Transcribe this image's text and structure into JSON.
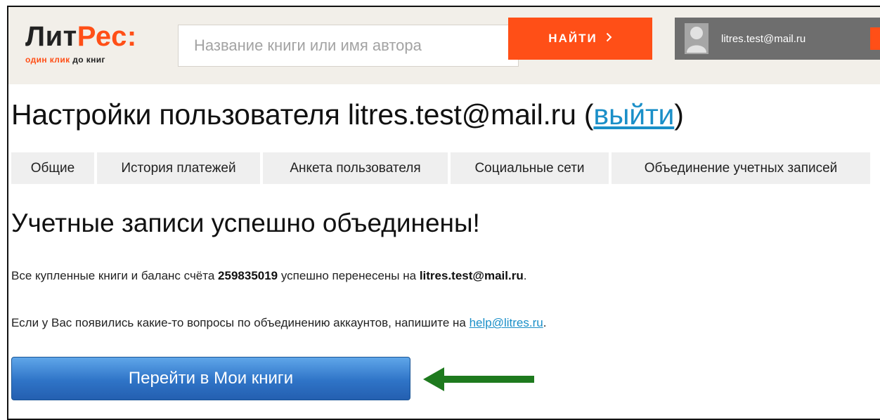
{
  "header": {
    "logo_part1": "Лит",
    "logo_part2": "Рес:",
    "tagline_part1": "один клик",
    "tagline_part2": " до книг",
    "search_placeholder": "Название книги или имя автора",
    "search_button": "НАЙТИ",
    "search_button_icon": "chevron-right-icon",
    "user_email": "litres.test@mail.ru"
  },
  "page": {
    "title_prefix": "Настройки пользователя litres.test@mail.ru (",
    "logout_link": "выйти",
    "title_suffix": ")"
  },
  "tabs": [
    {
      "label": "Общие"
    },
    {
      "label": "История платежей"
    },
    {
      "label": "Анкета пользователя"
    },
    {
      "label": "Социальные сети"
    },
    {
      "label": "Объединение учетных записей"
    }
  ],
  "content": {
    "success_title": "Учетные записи успешно объединены!",
    "line1_before": "Все купленные книги и баланс счёта ",
    "account_number": "259835019",
    "line1_middle": " успешно перенесены на ",
    "target_email": "litres.test@mail.ru",
    "line1_end": ".",
    "line2_before": "Если у Вас появились какие-то вопросы по объединению аккаунтов, напишите на ",
    "help_email": "help@litres.ru",
    "line2_end": ".",
    "go_button": "Перейти в Мои книги"
  },
  "colors": {
    "accent_orange": "#ff4f17",
    "link_blue": "#1a8fc8",
    "arrow_green": "#1e7a1e",
    "button_blue": "#2f74c7"
  }
}
